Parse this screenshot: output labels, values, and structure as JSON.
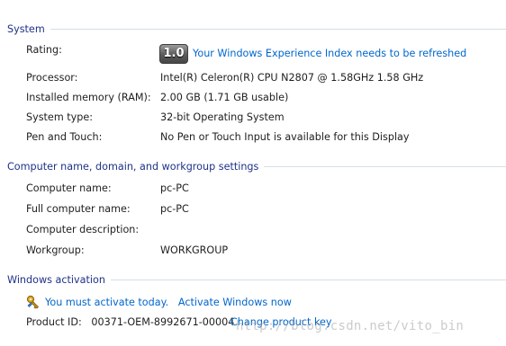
{
  "system": {
    "title": "System",
    "rating_label": "Rating:",
    "rating_score": "1.0",
    "rating_link": "Your Windows Experience Index needs to be refreshed",
    "processor_label": "Processor:",
    "processor_value": "Intel(R) Celeron(R) CPU  N2807  @ 1.58GHz   1.58 GHz",
    "memory_label": "Installed memory (RAM):",
    "memory_value": "2.00 GB (1.71 GB usable)",
    "type_label": "System type:",
    "type_value": "32-bit Operating System",
    "pen_label": "Pen and Touch:",
    "pen_value": "No Pen or Touch Input is available for this Display"
  },
  "computer": {
    "title": "Computer name, domain, and workgroup settings",
    "name_label": "Computer name:",
    "name_value": "pc-PC",
    "full_label": "Full computer name:",
    "full_value": "pc-PC",
    "desc_label": "Computer description:",
    "desc_value": "",
    "workgroup_label": "Workgroup:",
    "workgroup_value": "WORKGROUP"
  },
  "activation": {
    "title": "Windows activation",
    "message": "You must activate today.",
    "activate_link": "Activate Windows now",
    "product_label": "Product ID:",
    "product_value": "00371-OEM-8992671-00004",
    "change_key_link": "Change product key"
  },
  "watermark": "http://blog.csdn.net/vito_bin",
  "icons": {
    "key": "key-icon"
  },
  "colors": {
    "section_title": "#1e3287",
    "link": "#0066cc",
    "divider": "#d5dfe5"
  }
}
